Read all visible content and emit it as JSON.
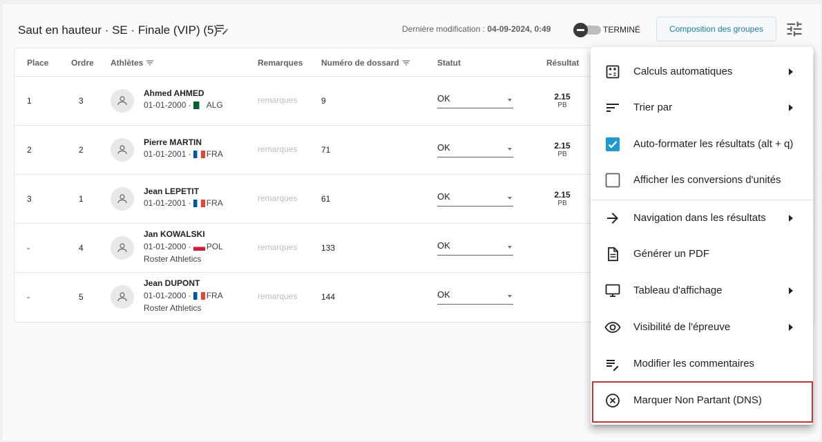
{
  "header": {
    "title": "Saut en hauteur · SE · Finale (VIP) (5)",
    "last_modified_label": "Dernière modification :",
    "last_modified_value": "04-09-2024, 0:49",
    "toggle_label": "TERMINÉ",
    "compose_button": "Composition des groupes"
  },
  "table": {
    "columns": {
      "place": "Place",
      "order": "Ordre",
      "athletes": "Athlètes",
      "remarks": "Remarques",
      "bib": "Numéro de dossard",
      "status": "Statut",
      "result": "Résultat"
    },
    "remark_placeholder": "remarques",
    "rows": [
      {
        "place": "1",
        "order": "3",
        "name": "Ahmed AHMED",
        "dob": "01-01-2000 ·",
        "country": "ALG",
        "club": "",
        "bib": "9",
        "status": "OK",
        "result": "2.15",
        "tag": "PB"
      },
      {
        "place": "2",
        "order": "2",
        "name": "Pierre MARTIN",
        "dob": "01-01-2001 ·",
        "country": "FRA",
        "club": "",
        "bib": "71",
        "status": "OK",
        "result": "2.15",
        "tag": "PB"
      },
      {
        "place": "3",
        "order": "1",
        "name": "Jean LEPETIT",
        "dob": "01-01-2001 ·",
        "country": "FRA",
        "club": "",
        "bib": "61",
        "status": "OK",
        "result": "2.15",
        "tag": "PB"
      },
      {
        "place": "-",
        "order": "4",
        "name": "Jan KOWALSKI",
        "dob": "01-01-2000 ·",
        "country": "POL",
        "club": "Roster Athletics",
        "bib": "133",
        "status": "OK",
        "result": "",
        "tag": ""
      },
      {
        "place": "-",
        "order": "5",
        "name": "Jean DUPONT",
        "dob": "01-01-2000 ·",
        "country": "FRA",
        "club": "Roster Athletics",
        "bib": "144",
        "status": "OK",
        "result": "",
        "tag": ""
      }
    ]
  },
  "menu": {
    "items": [
      {
        "label": "Calculs automatiques",
        "icon": "calculator-icon",
        "submenu": true
      },
      {
        "label": "Trier par",
        "icon": "sort-icon",
        "submenu": true
      },
      {
        "label": "Auto-formater les résultats (alt + q)",
        "icon": "checkbox-checked-icon",
        "checked": true
      },
      {
        "label": "Afficher les conversions d'unités",
        "icon": "checkbox-empty-icon",
        "checked": false
      },
      {
        "label": "Navigation dans les résultats",
        "icon": "arrow-right-icon",
        "submenu": true
      },
      {
        "label": "Générer un PDF",
        "icon": "document-icon",
        "submenu": false
      },
      {
        "label": "Tableau d'affichage",
        "icon": "monitor-icon",
        "submenu": true
      },
      {
        "label": "Visibilité de l'épreuve",
        "icon": "eye-icon",
        "submenu": true
      },
      {
        "label": "Modifier les commentaires",
        "icon": "edit-notes-icon",
        "submenu": false
      },
      {
        "label": "Marquer Non Partant (DNS)",
        "icon": "cancel-circle-icon",
        "submenu": false
      }
    ]
  },
  "colors": {
    "accent": "#1e7ca8",
    "checkbox": "#1a9bcf",
    "highlight": "#d32f2f"
  }
}
